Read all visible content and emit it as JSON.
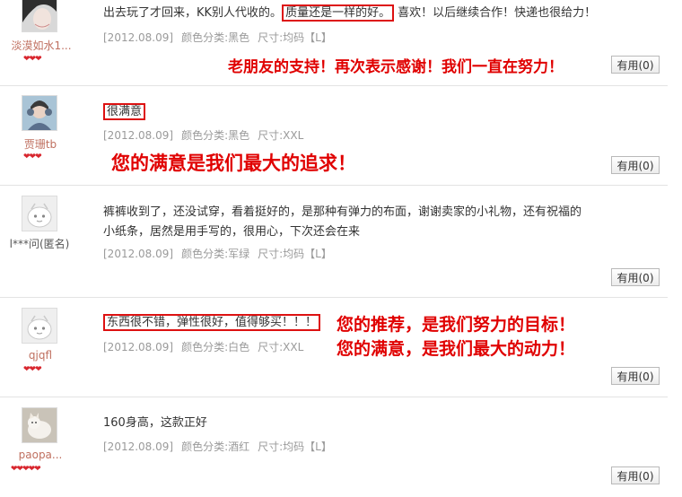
{
  "reviews": [
    {
      "username": "淡漠如水1...",
      "content_pre": "出去玩了才回来，KK别人代收的。",
      "content_boxed": "质量还是一样的好。",
      "content_post": "喜欢！以后继续合作！快递也很给力！",
      "date": "[2012.08.09]",
      "color": "颜色分类:黑色",
      "size": "尺寸:均码【L】",
      "seller_reply": "老朋友的支持！再次表示感谢！我们一直在努力！",
      "useful_label": "有用(0)"
    },
    {
      "username": "贾珊tb",
      "content_boxed": "很满意",
      "date": "[2012.08.09]",
      "color": "颜色分类:黑色",
      "size": "尺寸:XXL",
      "seller_reply": "您的满意是我们最大的追求！",
      "useful_label": "有用(0)"
    },
    {
      "username": "l***问(匿名)",
      "content_line1": "裤裤收到了，还没试穿，看着挺好的，是那种有弹力的布面，谢谢卖家的小礼物，还有祝福的",
      "content_line2": "小纸条，居然是用手写的，很用心，下次还会在来",
      "date": "[2012.08.09]",
      "color": "颜色分类:军绿",
      "size": "尺寸:均码【L】",
      "useful_label": "有用(0)"
    },
    {
      "username": "qjqfl",
      "content_boxed": "东西很不错，弹性很好，值得够买！！！",
      "date": "[2012.08.09]",
      "color": "颜色分类:白色",
      "size": "尺寸:XXL",
      "seller_reply_line1": "您的推荐，是我们努力的目标！",
      "seller_reply_line2": "您的满意，是我们最大的动力！",
      "useful_label": "有用(0)"
    },
    {
      "username": "paopa...",
      "content": "160身高，这款正好",
      "date": "[2012.08.09]",
      "color": "颜色分类:酒红",
      "size": "尺寸:均码【L】",
      "useful_label": "有用(0)"
    }
  ],
  "icons": {
    "rating": "heart-rating-icon",
    "anonymous_avatar": "anonymous-avatar-icon"
  },
  "colors": {
    "seller_reply": "#e00000",
    "highlight_box": "#dd1111",
    "meta_text": "#9a9a9a"
  }
}
